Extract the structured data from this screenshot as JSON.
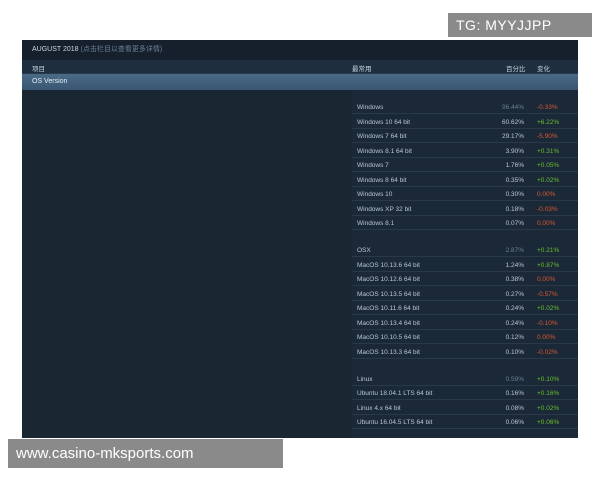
{
  "header": {
    "title": "AUGUST 2018",
    "subtitle": "(点击栏目以查看更多详情)"
  },
  "columns": {
    "item": "项目",
    "most_popular": "最常用",
    "percent": "百分比",
    "change": "变化"
  },
  "section": "OS Version",
  "rows": [
    {
      "kind": "group",
      "name": "Windows",
      "pct": "96.44%",
      "chg": "-0.33%",
      "dir": "neg"
    },
    {
      "kind": "row",
      "name": "Windows 10 64 bit",
      "pct": "60.62%",
      "chg": "+6.22%",
      "dir": "pos"
    },
    {
      "kind": "row",
      "name": "Windows 7 64 bit",
      "pct": "29.17%",
      "chg": "-5.90%",
      "dir": "neg"
    },
    {
      "kind": "row",
      "name": "Windows 8.1 64 bit",
      "pct": "3.90%",
      "chg": "+0.31%",
      "dir": "pos"
    },
    {
      "kind": "row",
      "name": "Windows 7",
      "pct": "1.76%",
      "chg": "+0.05%",
      "dir": "pos"
    },
    {
      "kind": "row",
      "name": "Windows 8 64 bit",
      "pct": "0.35%",
      "chg": "+0.02%",
      "dir": "pos"
    },
    {
      "kind": "row",
      "name": "Windows 10",
      "pct": "0.30%",
      "chg": "0.00%",
      "dir": "zero"
    },
    {
      "kind": "row",
      "name": "Windows XP 32 bit",
      "pct": "0.18%",
      "chg": "-0.03%",
      "dir": "neg"
    },
    {
      "kind": "row",
      "name": "Windows 8.1",
      "pct": "0.07%",
      "chg": "0.00%",
      "dir": "zero"
    },
    {
      "kind": "gap"
    },
    {
      "kind": "group",
      "name": "OSX",
      "pct": "2.87%",
      "chg": "+0.21%",
      "dir": "pos"
    },
    {
      "kind": "row",
      "name": "MacOS 10.13.6 64 bit",
      "pct": "1.24%",
      "chg": "+0.87%",
      "dir": "pos"
    },
    {
      "kind": "row",
      "name": "MacOS 10.12.6 64 bit",
      "pct": "0.38%",
      "chg": "0.00%",
      "dir": "zero"
    },
    {
      "kind": "row",
      "name": "MacOS 10.13.5 64 bit",
      "pct": "0.27%",
      "chg": "-0.57%",
      "dir": "neg"
    },
    {
      "kind": "row",
      "name": "MacOS 10.11.6 64 bit",
      "pct": "0.24%",
      "chg": "+0.02%",
      "dir": "pos"
    },
    {
      "kind": "row",
      "name": "MacOS 10.13.4 64 bit",
      "pct": "0.24%",
      "chg": "-0.10%",
      "dir": "neg"
    },
    {
      "kind": "row",
      "name": "MacOS 10.10.5 64 bit",
      "pct": "0.12%",
      "chg": "0.00%",
      "dir": "zero"
    },
    {
      "kind": "row",
      "name": "MacOS 10.13.3 64 bit",
      "pct": "0.10%",
      "chg": "-0.02%",
      "dir": "neg"
    },
    {
      "kind": "gap"
    },
    {
      "kind": "group",
      "name": "Linux",
      "pct": "0.59%",
      "chg": "+0.10%",
      "dir": "pos"
    },
    {
      "kind": "row",
      "name": "Ubuntu 18.04.1 LTS 64 bit",
      "pct": "0.16%",
      "chg": "+0.16%",
      "dir": "pos"
    },
    {
      "kind": "row",
      "name": "Linux 4.x 64 bit",
      "pct": "0.08%",
      "chg": "+0.02%",
      "dir": "pos"
    },
    {
      "kind": "row",
      "name": "Ubuntu 16.04.5 LTS 64 bit",
      "pct": "0.06%",
      "chg": "+0.06%",
      "dir": "pos"
    }
  ],
  "colors": {
    "panel_bg": "#1b2838",
    "positive": "#66c02d",
    "negative": "#d9582f",
    "section_bar": "#4a6a86"
  },
  "watermarks": {
    "tg": "TG: MYYJJPP",
    "url": "www.casino-mksports.com"
  }
}
